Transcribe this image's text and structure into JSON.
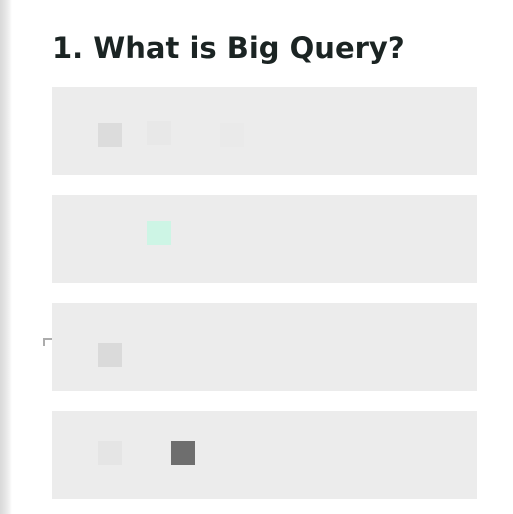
{
  "question": {
    "title": "1. What is Big Query?"
  },
  "options": [
    {
      "label": "",
      "glyphs": [
        {
          "icon": "placeholder-glyph-icon",
          "color": "#dcdcdc"
        },
        {
          "icon": "placeholder-glyph-icon",
          "color": "#e8e8e8"
        },
        {
          "icon": "placeholder-glyph-icon",
          "color": "#eaeaea"
        }
      ]
    },
    {
      "label": "",
      "glyphs": [
        {
          "icon": "placeholder-glyph-icon",
          "color": "#cdf5e5"
        }
      ]
    },
    {
      "label": "",
      "glyphs": [
        {
          "icon": "placeholder-glyph-icon",
          "color": "#dadada"
        }
      ]
    },
    {
      "label": "",
      "glyphs": [
        {
          "icon": "placeholder-glyph-icon",
          "color": "#e5e5e5"
        },
        {
          "icon": "placeholder-glyph-icon",
          "color": "#6e6e6e"
        }
      ]
    }
  ]
}
